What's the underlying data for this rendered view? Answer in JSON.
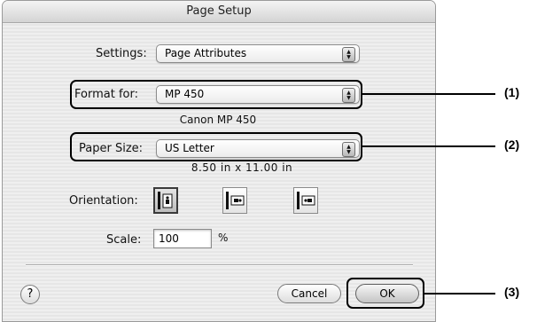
{
  "window": {
    "title": "Page Setup"
  },
  "settings": {
    "label": "Settings:",
    "value": "Page Attributes"
  },
  "format_for": {
    "label": "Format for:",
    "value": "MP 450",
    "description": "Canon MP 450"
  },
  "paper_size": {
    "label": "Paper Size:",
    "value": "US Letter",
    "dimensions": "8.50 in x 11.00 in"
  },
  "orientation": {
    "label": "Orientation:",
    "options": [
      "portrait",
      "landscape-left",
      "landscape-right"
    ],
    "selected": "portrait"
  },
  "scale": {
    "label": "Scale:",
    "value": "100",
    "unit": "%"
  },
  "buttons": {
    "help": "?",
    "cancel": "Cancel",
    "ok": "OK"
  },
  "callouts": [
    "(1)",
    "(2)",
    "(3)"
  ]
}
